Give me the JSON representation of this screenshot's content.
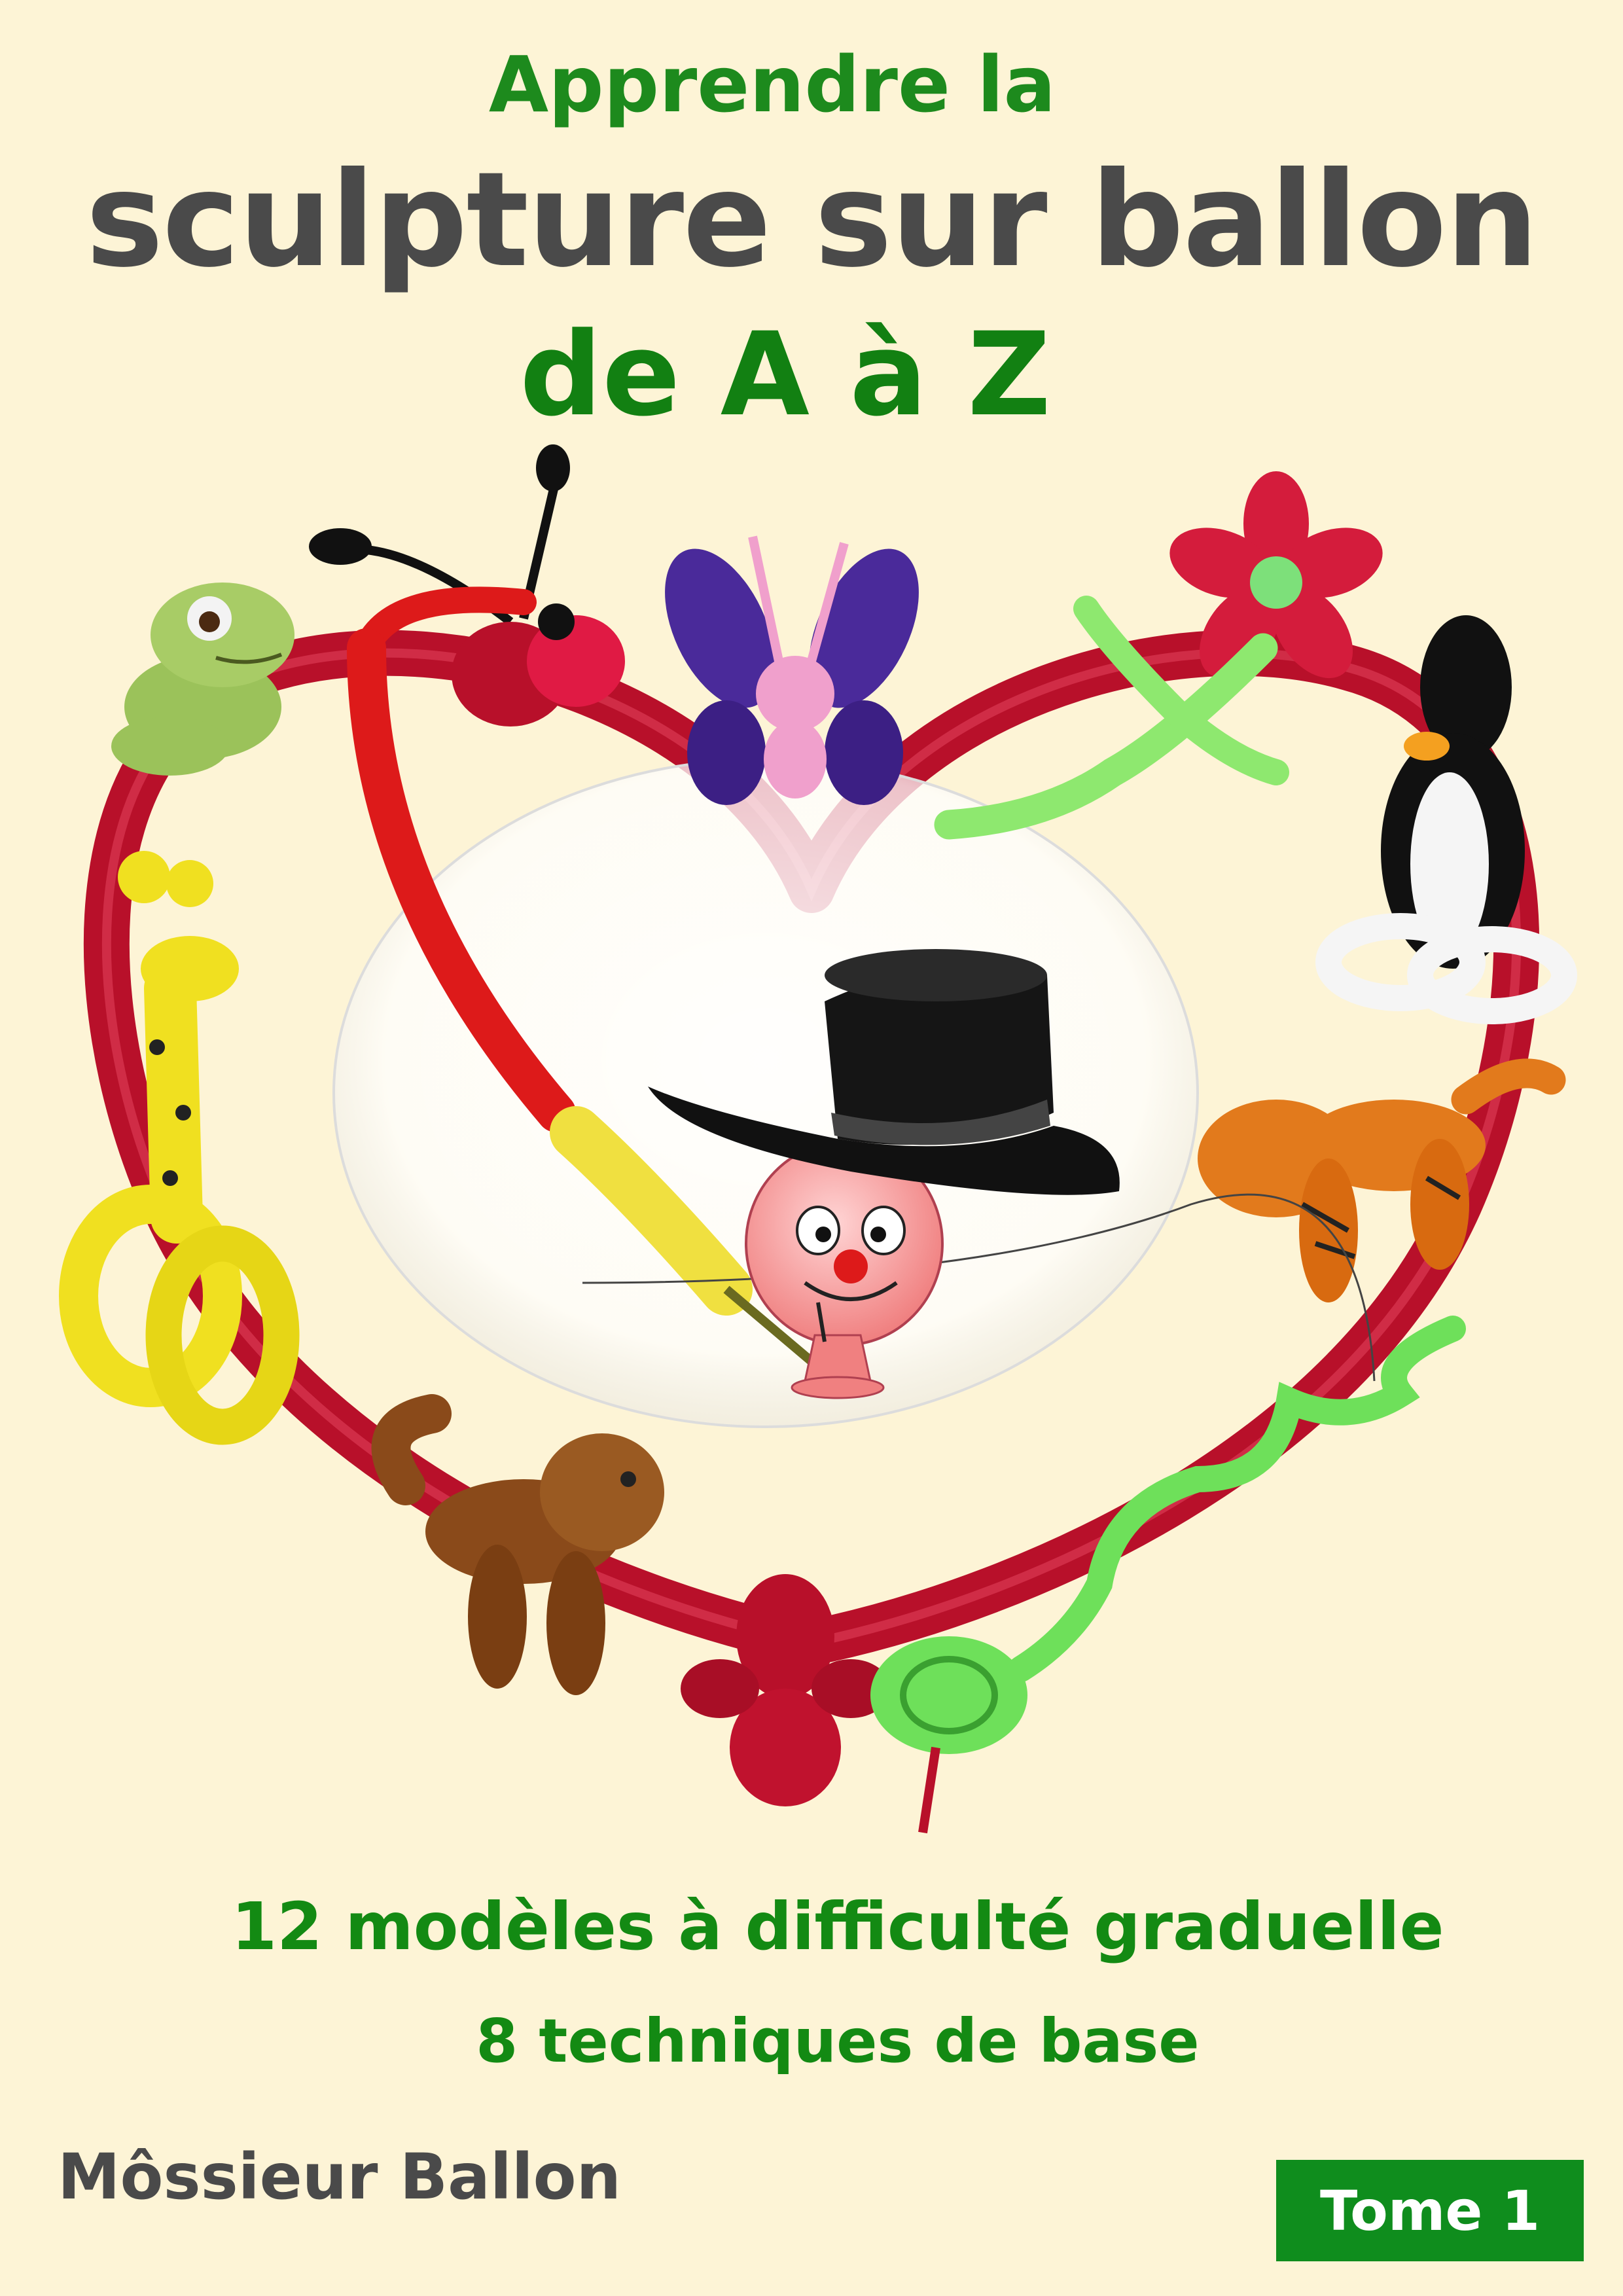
{
  "cover": {
    "title_line_1": "Apprendre la",
    "title_line_2": "sculpture sur ballon",
    "title_line_3": "de A à Z",
    "subtitle_1": "12 modèles à difficulté graduelle",
    "subtitle_2": "8 techniques de base",
    "author": "Môssieur Ballon",
    "volume": "Tome 1"
  },
  "colors": {
    "background": "#fdf4d6",
    "title_green": "#128012",
    "title_grey": "#4a4a4a",
    "heart_red": "#b8102a",
    "volume_badge": "#0f8d1d"
  },
  "artwork": {
    "icons": [
      "heart-balloon-icon",
      "frog-balloon-icon",
      "ladybug-balloon-icon",
      "butterfly-balloon-icon",
      "flower-balloon-icon",
      "penguin-balloon-icon",
      "giraffe-balloon-icon",
      "tiger-balloon-icon",
      "dog-balloon-icon",
      "snake-balloon-icon",
      "clown-with-top-hat-icon"
    ]
  }
}
